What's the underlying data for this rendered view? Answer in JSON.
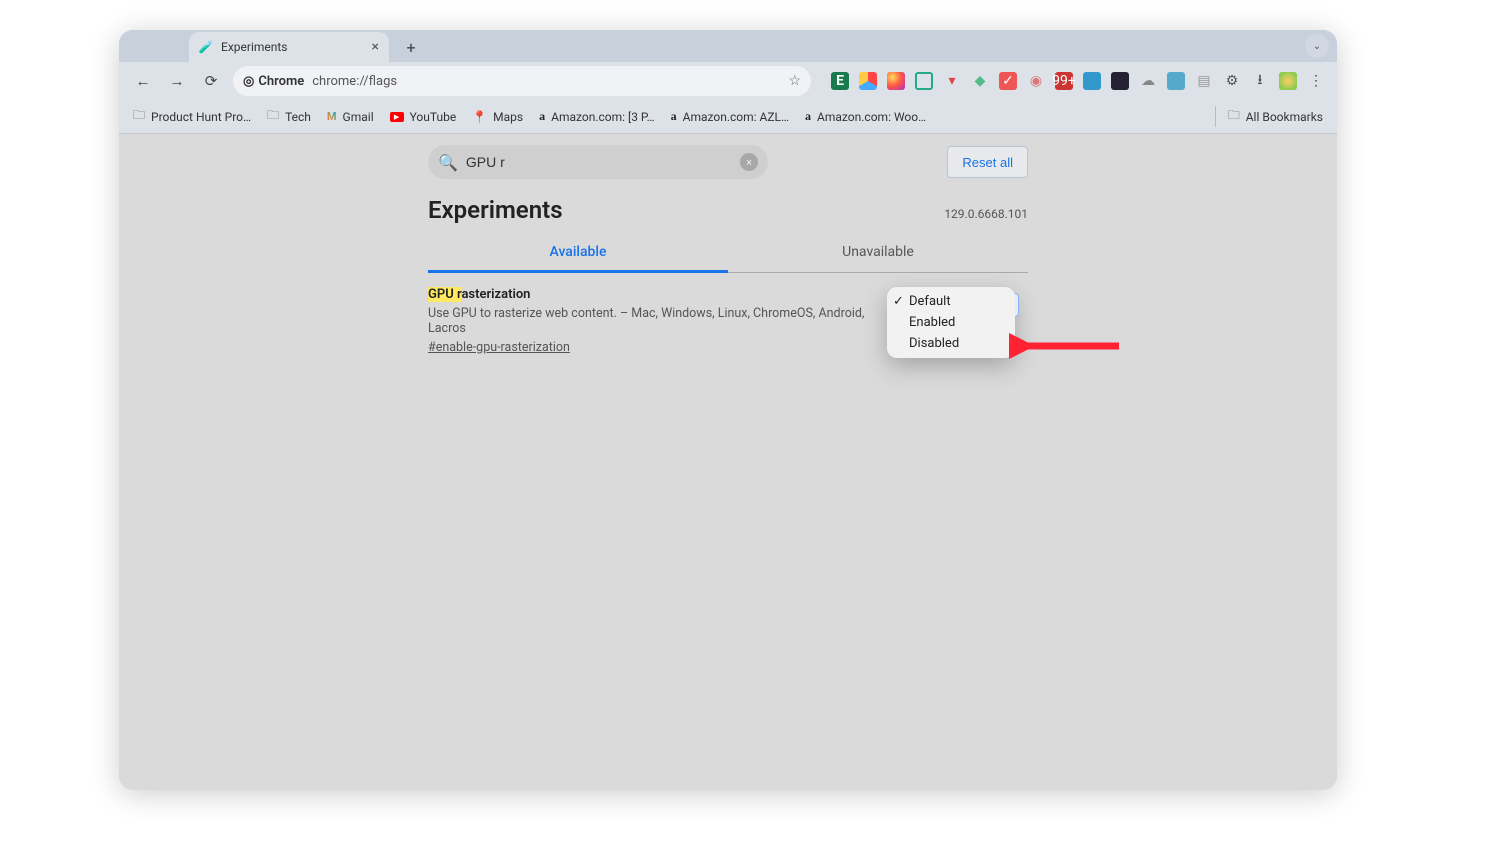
{
  "chrome": {
    "tab_title": "Experiments",
    "chip_label": "Chrome",
    "url": "chrome://flags",
    "all_bookmarks": "All Bookmarks"
  },
  "bookmarks": [
    {
      "label": "Product Hunt Pro…",
      "icon": "folder"
    },
    {
      "label": "Tech",
      "icon": "folder"
    },
    {
      "label": "Gmail",
      "icon": "gmail"
    },
    {
      "label": "YouTube",
      "icon": "youtube"
    },
    {
      "label": "Maps",
      "icon": "maps"
    },
    {
      "label": "Amazon.com: [3 P…",
      "icon": "amazon"
    },
    {
      "label": "Amazon.com: AZL…",
      "icon": "amazon"
    },
    {
      "label": "Amazon.com: Woo…",
      "icon": "amazon"
    }
  ],
  "flags": {
    "search_value": "GPU r",
    "reset_label": "Reset all",
    "page_title": "Experiments",
    "version": "129.0.6668.101",
    "tab_available": "Available",
    "tab_unavailable": "Unavailable",
    "flag_title_hl": "GPU r",
    "flag_title_rest": "asterization",
    "flag_desc": "Use GPU to rasterize web content. – Mac, Windows, Linux, ChromeOS, Android, Lacros",
    "flag_link": "#enable-gpu-rasterization",
    "dropdown": {
      "items": [
        "Default",
        "Enabled",
        "Disabled"
      ],
      "selected": "Default"
    }
  }
}
